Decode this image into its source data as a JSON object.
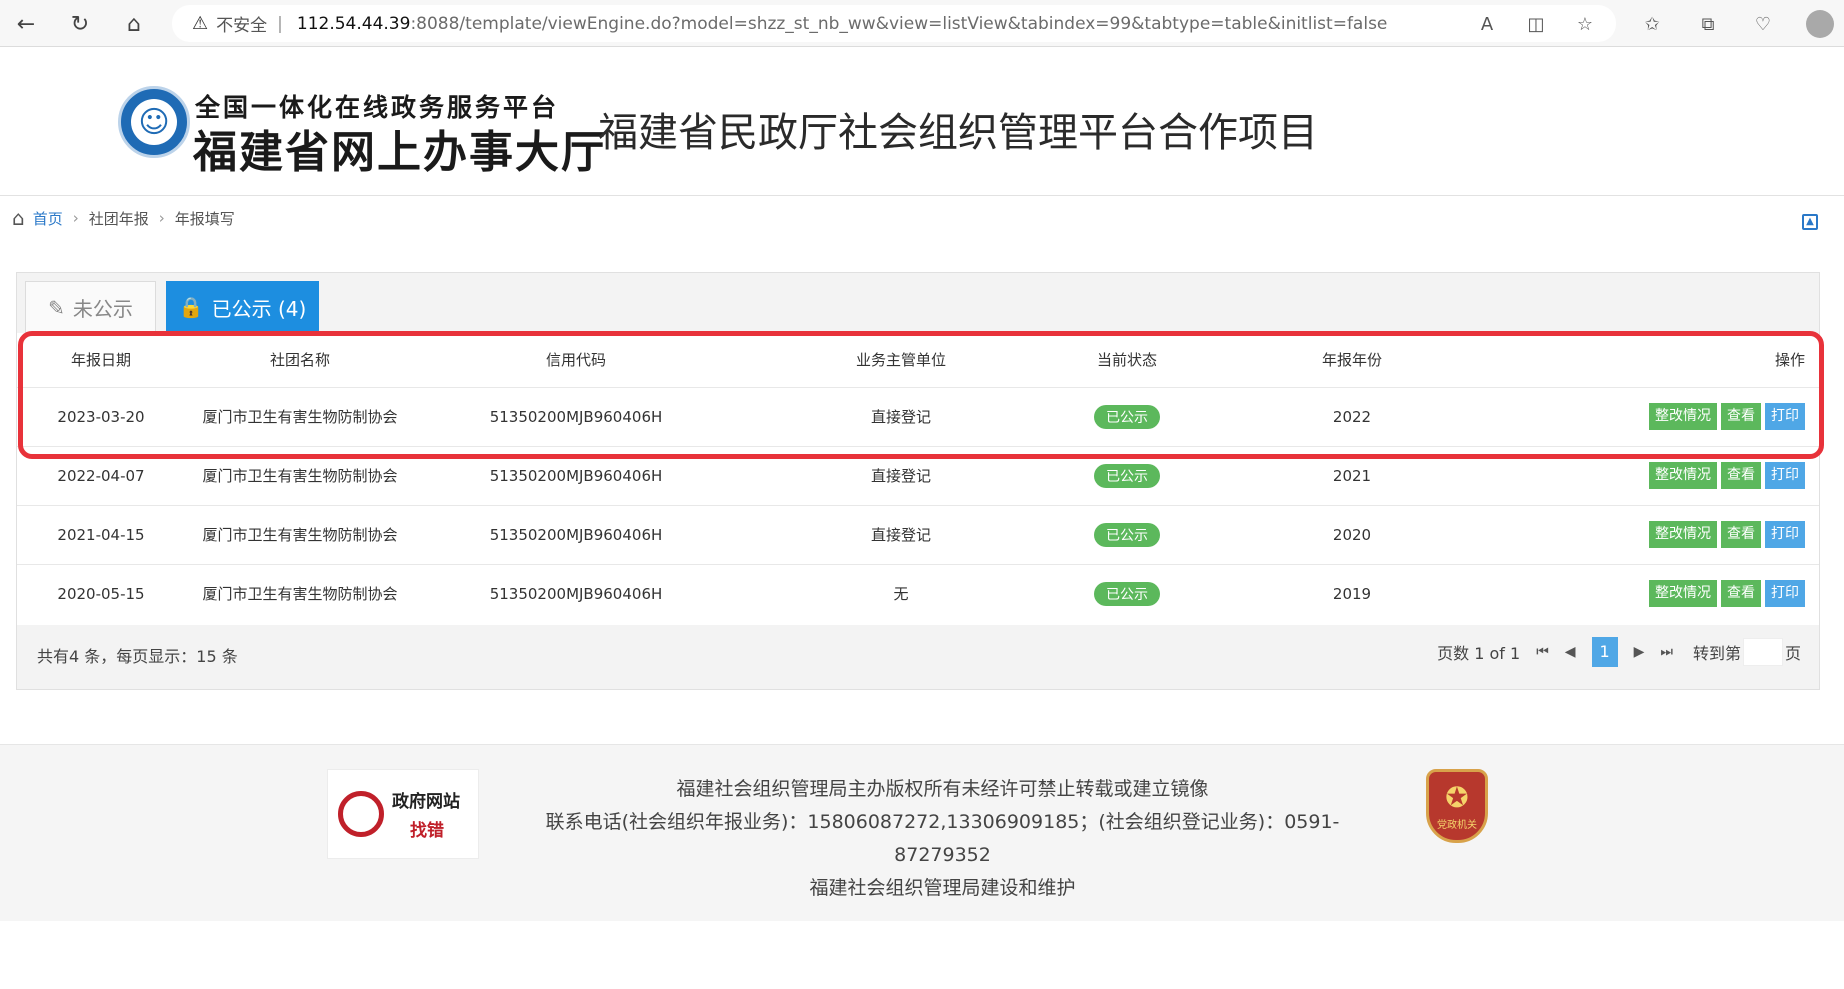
{
  "browser": {
    "security_label": "不安全",
    "url_host": "112.54.44.39",
    "url_path": ":8088/template/viewEngine.do?model=shzz_st_nb_ww&view=listView&tabindex=99&tabtype=table&initlist=false"
  },
  "header": {
    "logo_line1": "全国一体化在线政务服务平台",
    "logo_line2": "福建省网上办事大厅",
    "project_title": "福建省民政厅社会组织管理平台合作项目"
  },
  "breadcrumb": {
    "home": "首页",
    "level1": "社团年报",
    "level2": "年报填写"
  },
  "tabs": {
    "unpublished": "未公示",
    "published": "已公示 (4)"
  },
  "table": {
    "headers": [
      "年报日期",
      "社团名称",
      "信用代码",
      "业务主管单位",
      "当前状态",
      "年报年份",
      "操作"
    ],
    "rows": [
      {
        "date": "2023-03-20",
        "name": "厦门市卫生有害生物防制协会",
        "code": "51350200MJB960406H",
        "dept": "直接登记",
        "status": "已公示",
        "year": "2022"
      },
      {
        "date": "2022-04-07",
        "name": "厦门市卫生有害生物防制协会",
        "code": "51350200MJB960406H",
        "dept": "直接登记",
        "status": "已公示",
        "year": "2021"
      },
      {
        "date": "2021-04-15",
        "name": "厦门市卫生有害生物防制协会",
        "code": "51350200MJB960406H",
        "dept": "直接登记",
        "status": "已公示",
        "year": "2020"
      },
      {
        "date": "2020-05-15",
        "name": "厦门市卫生有害生物防制协会",
        "code": "51350200MJB960406H",
        "dept": "无",
        "status": "已公示",
        "year": "2019"
      }
    ],
    "actions": {
      "rectify": "整改情况",
      "view": "查看",
      "print": "打印"
    }
  },
  "pagination": {
    "summary": "共有4 条，每页显示：15 条",
    "page_info": "页数 1 of 1",
    "current_page": "1",
    "goto_prefix": "转到第",
    "goto_suffix": "页"
  },
  "footer": {
    "badge_line1": "政府网站",
    "badge_line2": "找错",
    "line1": "福建社会组织管理局主办版权所有未经许可禁止转载或建立镜像",
    "line2": "联系电话(社会组织年报业务)：15806087272,13306909185；(社会组织登记业务)：0591-87279352",
    "line3": "福建社会组织管理局建设和维护",
    "party_label": "党政机关"
  },
  "colors": {
    "accent_blue": "#1d8ee0",
    "status_green": "#5cb85c",
    "highlight_red": "#e8323a"
  }
}
